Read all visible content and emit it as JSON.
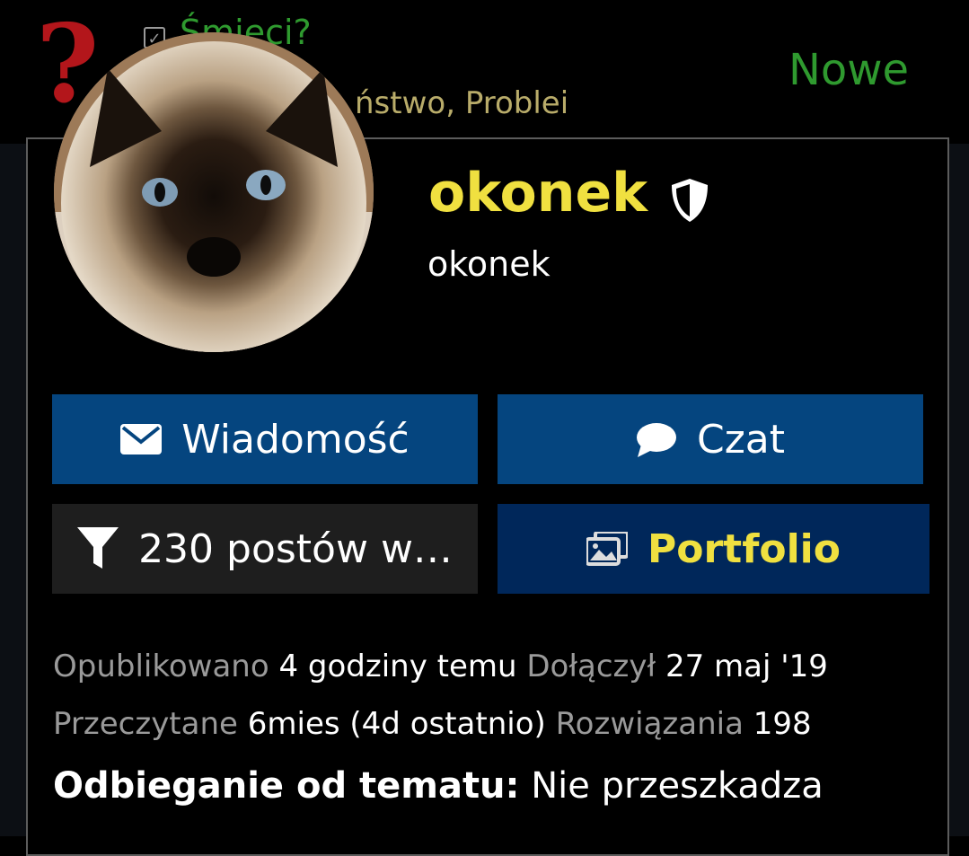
{
  "background": {
    "topic_title": "Śmieci?",
    "topic_tags": "ństwo, Problei",
    "new_label": "Nowe",
    "question_mark": "?"
  },
  "profile": {
    "display_name": "okonek",
    "username": "okonek",
    "avatar_alt": "cat avatar",
    "badge_icon": "shield-icon"
  },
  "buttons": {
    "message_label": "Wiadomość",
    "chat_label": "Czat",
    "posts_label": "230 postów w…",
    "portfolio_label": "Portfolio"
  },
  "stats": {
    "posted_label": "Opublikowano",
    "posted_value": "4 godziny temu",
    "joined_label": "Dołączył",
    "joined_value": "27 maj '19",
    "read_label": "Przeczytane",
    "read_value": "6mies (4d ostatnio)",
    "solutions_label": "Rozwiązania",
    "solutions_value": "198"
  },
  "offtopic": {
    "label": "Odbieganie od tematu:",
    "value": "Nie przeszkadza"
  },
  "colors": {
    "name_yellow": "#f0e040",
    "button_blue": "#05457f",
    "button_navy": "#00275a",
    "button_dark": "#1e1e1e",
    "topic_green": "#2f9a2f"
  }
}
